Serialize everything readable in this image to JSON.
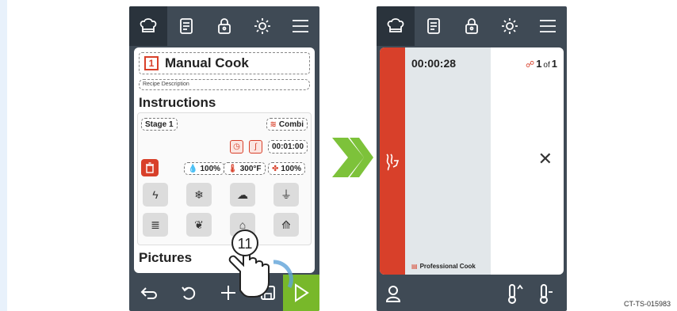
{
  "left_screen": {
    "recipe": {
      "number": "1",
      "title": "Manual Cook",
      "description_placeholder": "Recipe Description"
    },
    "instructions_heading": "Instructions",
    "stage": {
      "label": "Stage 1",
      "mode": "Combi",
      "time": "00:01:00",
      "humidity": "100%",
      "temperature": "300°F",
      "fan": "100%"
    },
    "pictures_heading": "Pictures",
    "step_callout": "11"
  },
  "right_screen": {
    "timer": "00:00:28",
    "count_current": "1",
    "count_of": "of",
    "count_total": "1",
    "footer_label": "Professional Cook"
  },
  "document_id": "CT-TS-015983",
  "colors": {
    "accent_red": "#d8402a",
    "accent_green": "#78b82a",
    "device_dark": "#3f4a55"
  }
}
